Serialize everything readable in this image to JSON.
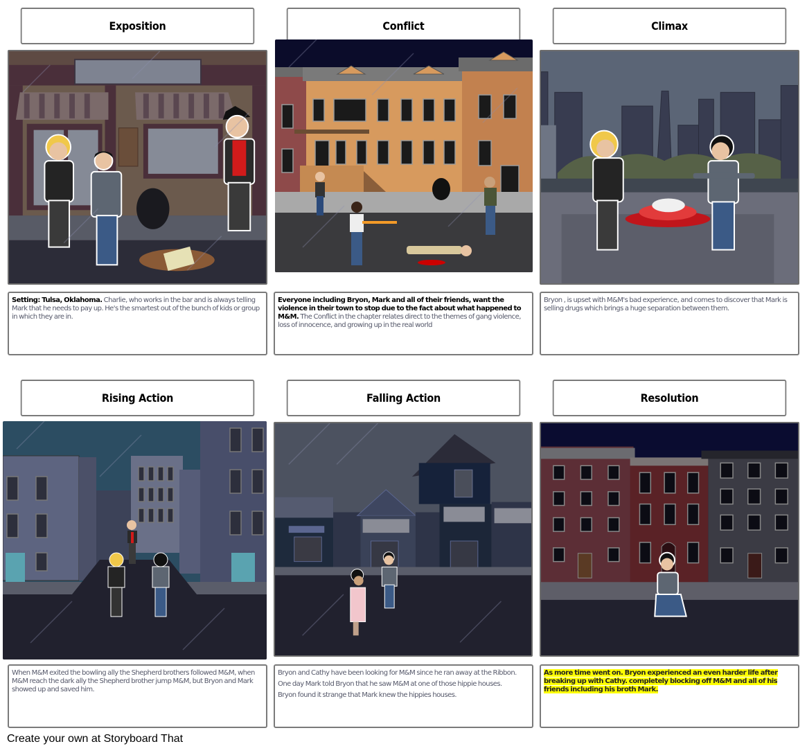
{
  "storyboard": {
    "cells": [
      {
        "title": "Exposition",
        "scene": "rainy-street-storefront",
        "desc_bold": "Setting: Tulsa, Oklahoma.",
        "desc_text": " Charlie, who works in the bar and is always telling Mark that he needs to pay up. He's the smartest out of the bunch of kids or group in which they are in."
      },
      {
        "title": "Conflict",
        "scene": "row-houses-shooting",
        "desc_bold": "Everyone including Bryon, Mark and all of their friends, want the violence in their town to stop due to the fact about what happened to M&M.",
        "desc_text": " The Conflict in the chapter relates direct to the themes of gang violence, loss of innocence, and growing up in the real world"
      },
      {
        "title": "Climax",
        "scene": "rooftop-pills",
        "desc_bold": "",
        "desc_text": "Bryon , is upset with M&M's bad experience, and comes to discover that Mark is selling drugs which brings a huge separation between them."
      },
      {
        "title": "Rising Action",
        "scene": "dark-alley-city",
        "desc_bold": "",
        "desc_text": "When M&M exited the bowling ally the Shepherd brothers followed M&M, when M&M reach the dark ally the Shepherd brother jump M&M, but Bryon and Mark showed up and saved him."
      },
      {
        "title": "Falling Action",
        "scene": "strip-mall-night",
        "desc_bold": "",
        "desc_lines": [
          "Bryon and Cathy have been looking for M&M since he ran away at the Ribbon.",
          "One day Mark told Bryon that he saw M&M at one of those hippie houses.",
          "Bryon found it strange that Mark knew the hippies houses."
        ]
      },
      {
        "title": "Resolution",
        "scene": "brick-townhouses-kneeling",
        "desc_highlight": "As more time went on. Bryon experienced an even harder life after breaking up with Cathy. completely blocking off M&M and all of his friends including his broth Mark."
      }
    ]
  },
  "footer": {
    "text": "Create your own at Storyboard That"
  },
  "colors": {
    "highlight": "#ffff00",
    "border": "#7a7a7a",
    "desc_text": "#55586a"
  }
}
